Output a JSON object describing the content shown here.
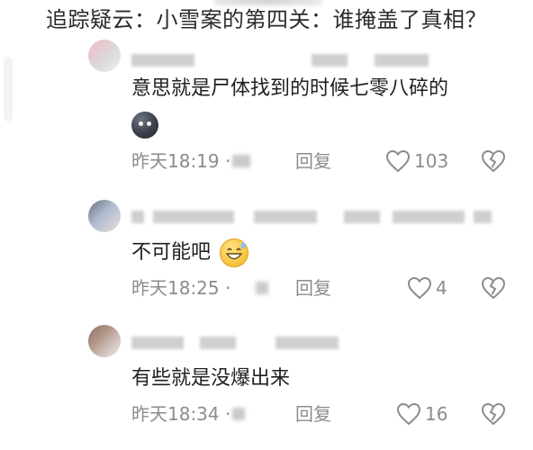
{
  "title": "追踪疑云：小雪案的第四关：谁掩盖了真相？",
  "comments": [
    {
      "text": "意思就是尸体找到的时候七零八碎的",
      "time": "昨天18:19 ·",
      "reply_label": "回复",
      "likes": "103"
    },
    {
      "text": "不可能吧",
      "time": "昨天18:25 ·",
      "reply_label": "回复",
      "likes": "4"
    },
    {
      "text": "有些就是没爆出来",
      "time": "昨天18:34 ·",
      "reply_label": "回复",
      "likes": "16"
    }
  ],
  "colors": {
    "meta": "#8c8c8c",
    "text": "#1f1f1f"
  },
  "icons": [
    "heart-outline-icon",
    "broken-heart-icon",
    "emoji-sticker"
  ]
}
